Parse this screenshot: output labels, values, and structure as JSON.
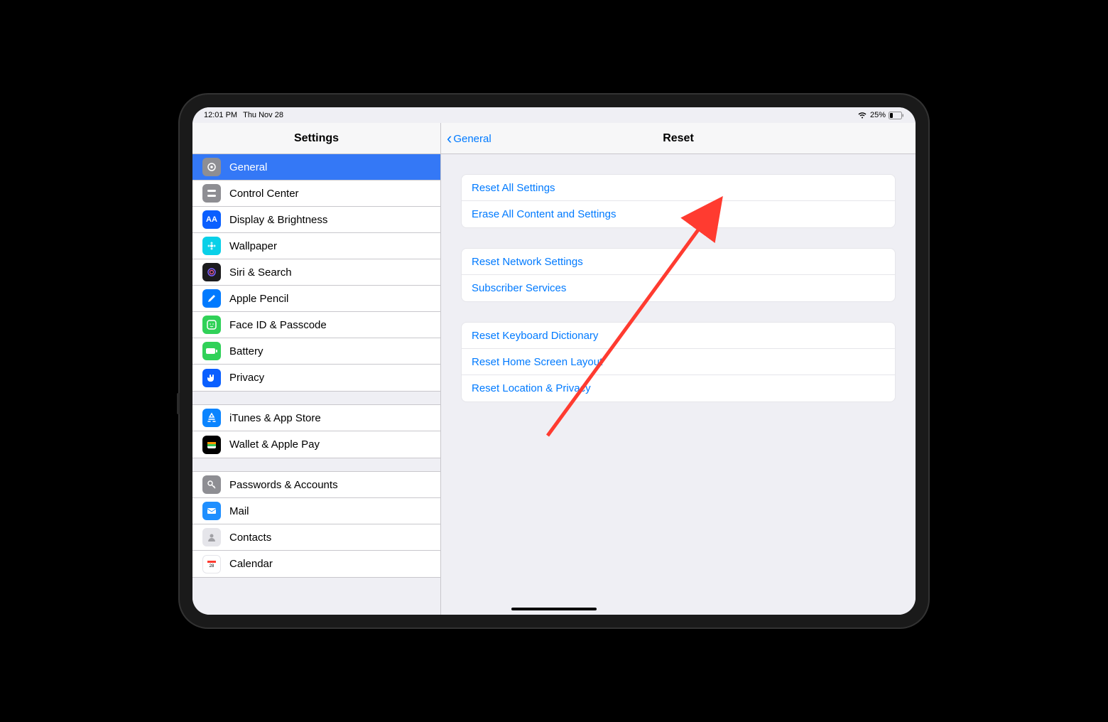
{
  "status": {
    "time": "12:01 PM",
    "date": "Thu Nov 28",
    "battery_pct": "25%"
  },
  "sidebar": {
    "title": "Settings",
    "groups": [
      [
        {
          "icon": "gear",
          "label": "General",
          "selected": true
        },
        {
          "icon": "control",
          "label": "Control Center"
        },
        {
          "icon": "display",
          "label": "Display & Brightness"
        },
        {
          "icon": "wallpaper",
          "label": "Wallpaper"
        },
        {
          "icon": "siri",
          "label": "Siri & Search"
        },
        {
          "icon": "pencil",
          "label": "Apple Pencil"
        },
        {
          "icon": "faceid",
          "label": "Face ID & Passcode"
        },
        {
          "icon": "battery",
          "label": "Battery"
        },
        {
          "icon": "privacy",
          "label": "Privacy"
        }
      ],
      [
        {
          "icon": "itunes",
          "label": "iTunes & App Store"
        },
        {
          "icon": "wallet",
          "label": "Wallet & Apple Pay"
        }
      ],
      [
        {
          "icon": "passwords",
          "label": "Passwords & Accounts"
        },
        {
          "icon": "mail",
          "label": "Mail"
        },
        {
          "icon": "contacts",
          "label": "Contacts"
        },
        {
          "icon": "calendar",
          "label": "Calendar"
        }
      ]
    ]
  },
  "detail": {
    "back_label": "General",
    "title": "Reset",
    "groups": [
      [
        "Reset All Settings",
        "Erase All Content and Settings"
      ],
      [
        "Reset Network Settings",
        "Subscriber Services"
      ],
      [
        "Reset Keyboard Dictionary",
        "Reset Home Screen Layout",
        "Reset Location & Privacy"
      ]
    ]
  },
  "annotation": {
    "arrow_target": "Reset All Settings"
  }
}
